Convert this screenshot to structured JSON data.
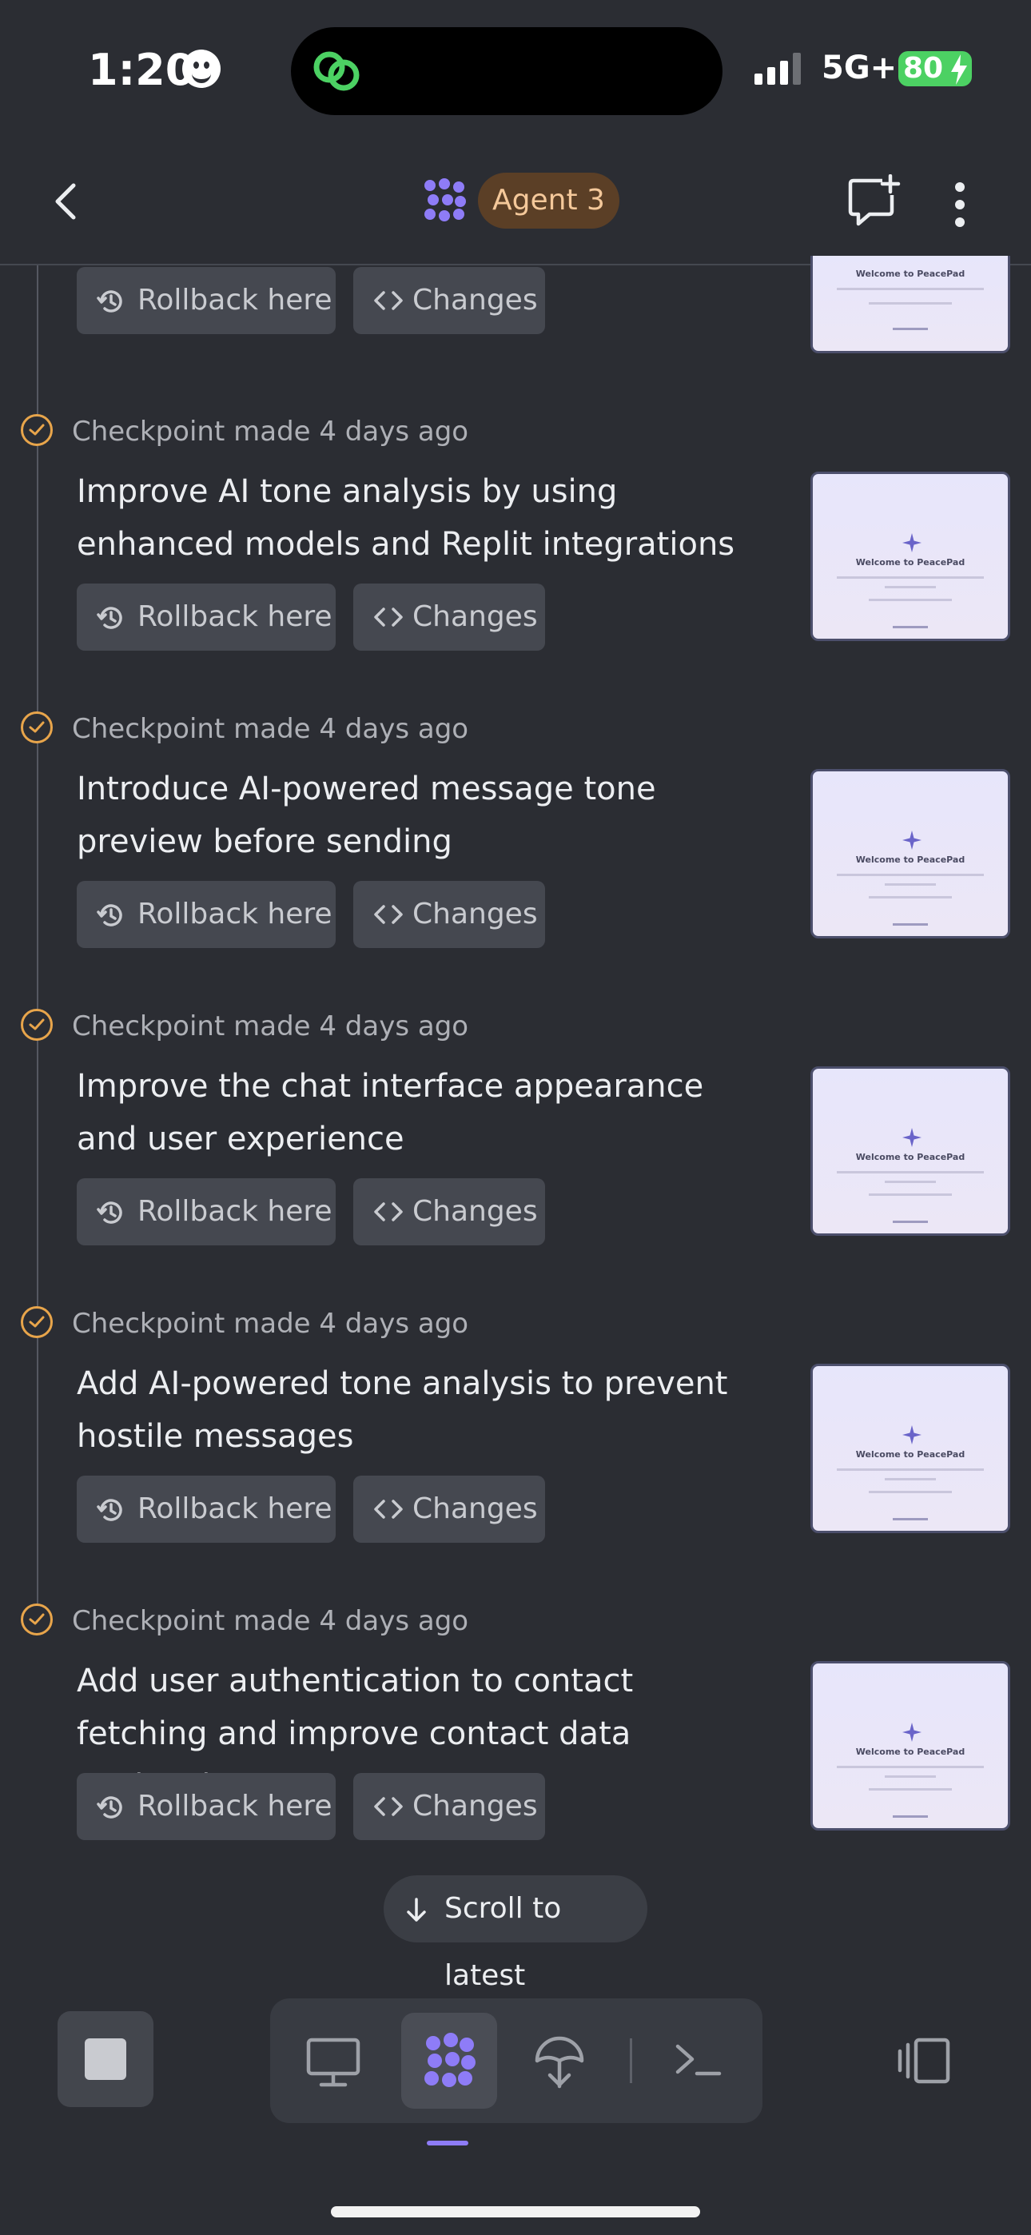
{
  "status_bar": {
    "time": "1:20",
    "network": "5G+",
    "battery": "80",
    "battery_color": "#4cd163"
  },
  "header": {
    "agent_label": "Agent 3",
    "icons": [
      "back-chevron-icon",
      "agent-logo-icon",
      "new-chat-icon",
      "more-vertical-icon"
    ]
  },
  "timeline": {
    "top_partial": {
      "rollback_label": "Rollback here",
      "changes_label": "Changes"
    },
    "checkpoints": [
      {
        "header": "Checkpoint made 4 days ago",
        "title": "Improve AI tone analysis by using enhanced models and Replit integrations",
        "rollback_label": "Rollback here",
        "changes_label": "Changes"
      },
      {
        "header": "Checkpoint made 4 days ago",
        "title": "Introduce AI-powered message tone preview before sending",
        "rollback_label": "Rollback here",
        "changes_label": "Changes"
      },
      {
        "header": "Checkpoint made 4 days ago",
        "title": "Improve the chat interface appearance and user experience",
        "rollback_label": "Rollback here",
        "changes_label": "Changes"
      },
      {
        "header": "Checkpoint made 4 days ago",
        "title": "Add AI-powered tone analysis to prevent hostile messages",
        "rollback_label": "Rollback here",
        "changes_label": "Changes"
      },
      {
        "header": "Checkpoint made 4 days ago",
        "title": "Add user authentication to contact fetching and improve contact data retrieval",
        "rollback_label": "Rollback here",
        "changes_label": "Changes"
      }
    ],
    "thumbnail_title": "Welcome to PeacePad"
  },
  "scroll_latest_label": "Scroll to latest",
  "toolbar": {
    "items": [
      "stop-icon",
      "desktop-preview-icon",
      "agent-icon",
      "deploy-icon",
      "terminal-icon",
      "panel-toggle-icon"
    ],
    "accent": "#8e7cf7"
  }
}
